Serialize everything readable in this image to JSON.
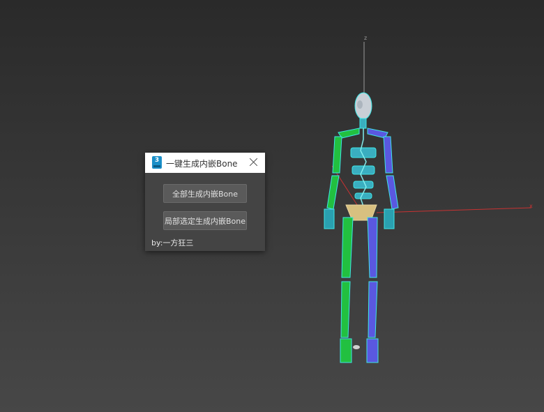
{
  "viewport": {
    "axis_z_label": "z",
    "axis_x_label": "x",
    "colors": {
      "bone_cyan": "#3fe6e6",
      "limb_green": "#22c040",
      "limb_blue": "#5a58e0",
      "spine": "#3aaec0",
      "head": "#c9cfd6",
      "pelvis": "#d8c080",
      "axis_x": "#c83232",
      "axis_z": "#9a9a9a"
    }
  },
  "dialog": {
    "app_icon_text": "3",
    "title": "一键生成内嵌Bone",
    "buttons": {
      "generate_all": "全部生成内嵌Bone",
      "generate_selected": "局部选定生成内嵌Bone"
    },
    "credit": "by:一方狂三"
  }
}
